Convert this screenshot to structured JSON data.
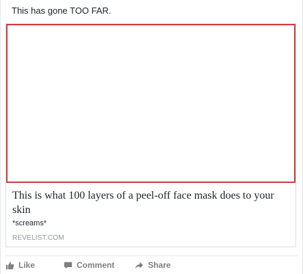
{
  "post": {
    "text": "This has gone TOO FAR.",
    "link": {
      "title": "This is what 100 layers of a peel-off face mask does to your skin",
      "description": "*screams*",
      "source": "REVELIST.COM"
    },
    "actions": {
      "like_label": "Like",
      "comment_label": "Comment",
      "share_label": "Share"
    }
  },
  "colors": {
    "image_border": "#d0393e",
    "action_text": "#7f7f7f",
    "source_text": "#90949c"
  },
  "icons": {
    "like": "thumbs-up-icon",
    "comment": "comment-bubble-icon",
    "share": "share-arrow-icon"
  }
}
